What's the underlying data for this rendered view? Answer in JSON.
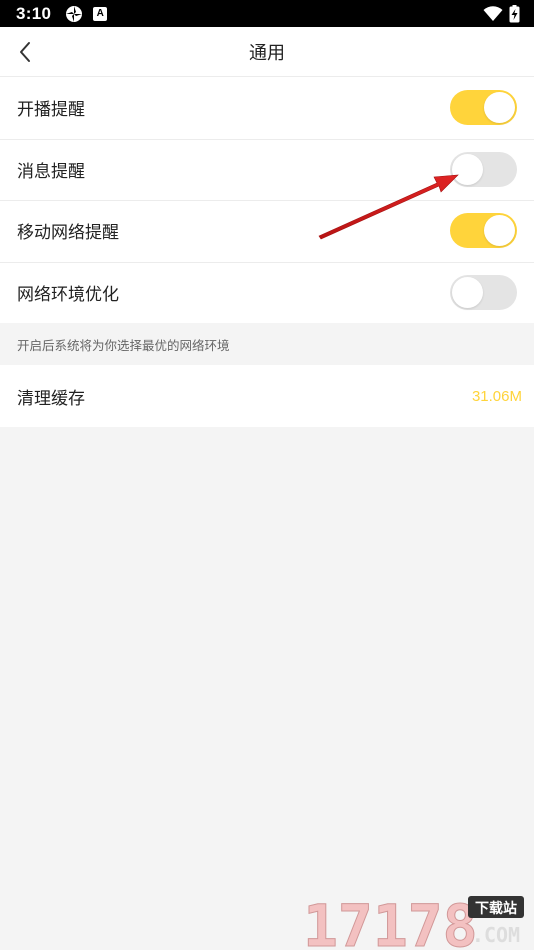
{
  "status_bar": {
    "time": "3:10",
    "icons_left": [
      "target-icon",
      "a-badge-icon"
    ],
    "icons_right": [
      "wifi-icon",
      "battery-charging-icon"
    ],
    "a_badge": "A"
  },
  "header": {
    "title": "通用",
    "back_icon": "chevron-left-icon"
  },
  "settings": [
    {
      "label": "开播提醒",
      "enabled": true
    },
    {
      "label": "消息提醒",
      "enabled": false
    },
    {
      "label": "移动网络提醒",
      "enabled": true
    },
    {
      "label": "网络环境优化",
      "enabled": false
    }
  ],
  "hint": "开启后系统将为你选择最优的网络环境",
  "cache": {
    "label": "清理缓存",
    "value": "31.06M"
  },
  "colors": {
    "accent": "#ffd43b",
    "toggle_off": "#e4e4e4",
    "background": "#f4f4f4",
    "annotation_arrow": "#d91e1e"
  },
  "watermark": {
    "logo_text": "17178",
    "badge": "下载站",
    "domain": ".COM"
  }
}
